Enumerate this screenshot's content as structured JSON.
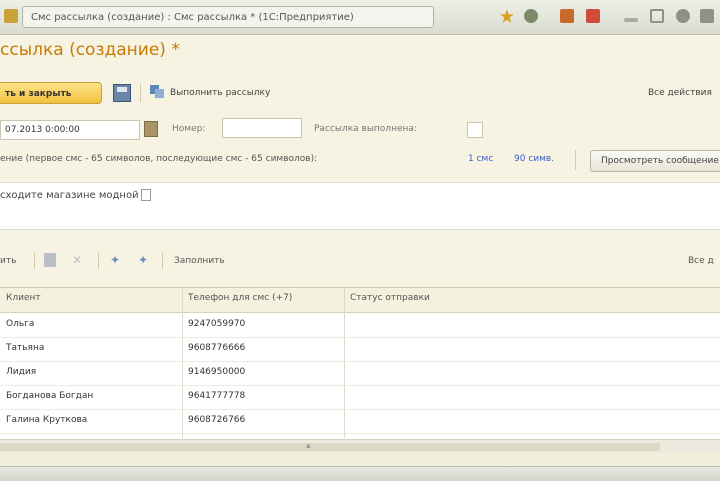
{
  "titlebar": {
    "tab_label": "Смс рассылка (создание) : Смс рассылка * (1С:Предприятие)",
    "colors": {
      "star": "#d6a020",
      "gear": "#7d8a6a",
      "calc": "#c66a2e",
      "close": "#d04b3a"
    }
  },
  "document": {
    "title": "ссылка (создание) *"
  },
  "toolbar": {
    "primary_label": "ть и закрыть",
    "execute_label": "Выполнить рассылку",
    "all_actions_label": "Все действия"
  },
  "form": {
    "date_value": "07.2013 0:00:00",
    "number_label": "Номер:",
    "number_value": "",
    "done_label": "Рассылка выполнена:"
  },
  "info": {
    "text": "ение (первое смс  - 65 символов, последующие смс - 65 символов):",
    "sms_count": "1 смс",
    "chars": "90 симв.",
    "preview_button": "Просмотреть сообщение"
  },
  "message": {
    "text": "сходите магазине модной"
  },
  "table_toolbar": {
    "add_label": "ить",
    "fill_label": "Заполнить",
    "all_actions_label": "Все д"
  },
  "table": {
    "columns": [
      "Клиент",
      "Телефон для смс (+7)",
      "Статус отправки"
    ],
    "rows": [
      {
        "client": "Ольга",
        "phone": "9247059970",
        "status": ""
      },
      {
        "client": "Татьяна",
        "phone": "9608776666",
        "status": ""
      },
      {
        "client": "Лидия",
        "phone": "9146950000",
        "status": ""
      },
      {
        "client": "Богданова Богдан",
        "phone": "9641777778",
        "status": ""
      },
      {
        "client": "Галина Круткова",
        "phone": "9608726766",
        "status": ""
      }
    ]
  }
}
